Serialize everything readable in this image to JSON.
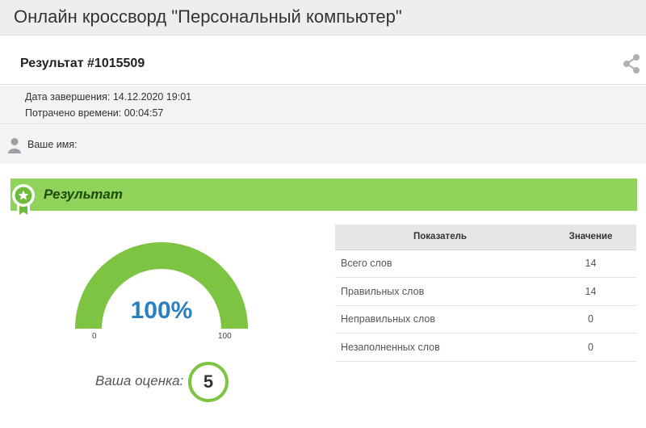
{
  "page": {
    "title": "Онлайн кроссворд \"Персональный компьютер\""
  },
  "result": {
    "id_label": "Результат #1015509",
    "finish_label": "Дата завершения: 14.12.2020 19:01",
    "time_label": "Потрачено времени: 00:04:57",
    "name_label": "Ваше имя:"
  },
  "section": {
    "title": "Результат"
  },
  "gauge": {
    "value": 100,
    "percent_text": "100%",
    "min_label": "0",
    "max_label": "100"
  },
  "grade": {
    "label": "Ваша оценка:",
    "value": "5"
  },
  "stats": {
    "headers": [
      "Показатель",
      "Значение"
    ],
    "rows": [
      [
        "Всего слов",
        "14"
      ],
      [
        "Правильных слов",
        "14"
      ],
      [
        "Неправильных слов",
        "0"
      ],
      [
        "Незаполненных слов",
        "0"
      ]
    ]
  },
  "icons": {
    "share": "share-icon",
    "user": "user-icon",
    "medal": "medal-star-icon"
  },
  "colors": {
    "accent_green": "#8fd35b",
    "gauge_green": "#7cc442",
    "percent_blue": "#2a7fc1",
    "section_text": "#1f4a0c"
  }
}
